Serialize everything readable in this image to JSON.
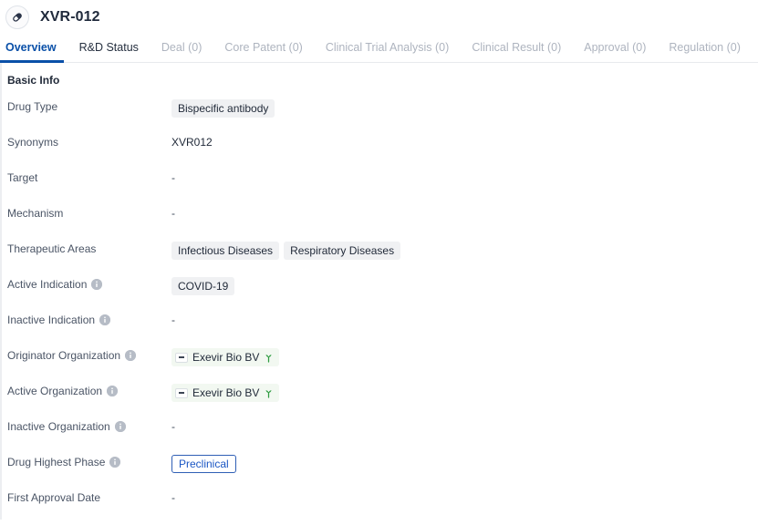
{
  "header": {
    "title": "XVR-012",
    "icon": "pill-capsule-icon"
  },
  "tabs": [
    {
      "label": "Overview",
      "state": "active"
    },
    {
      "label": "R&D Status",
      "state": "enabled"
    },
    {
      "label": "Deal (0)",
      "state": "disabled"
    },
    {
      "label": "Core Patent (0)",
      "state": "disabled"
    },
    {
      "label": "Clinical Trial Analysis (0)",
      "state": "disabled"
    },
    {
      "label": "Clinical Result (0)",
      "state": "disabled"
    },
    {
      "label": "Approval (0)",
      "state": "disabled"
    },
    {
      "label": "Regulation (0)",
      "state": "disabled"
    }
  ],
  "section": {
    "title": "Basic Info"
  },
  "fields": {
    "drug_type": {
      "label": "Drug Type",
      "tags": [
        "Bispecific antibody"
      ]
    },
    "synonyms": {
      "label": "Synonyms",
      "value": "XVR012"
    },
    "target": {
      "label": "Target",
      "value": "-"
    },
    "mechanism": {
      "label": "Mechanism",
      "value": "-"
    },
    "therapeutic_areas": {
      "label": "Therapeutic Areas",
      "tags": [
        "Infectious Diseases",
        "Respiratory Diseases"
      ]
    },
    "active_indication": {
      "label": "Active Indication",
      "has_info": true,
      "tags": [
        "COVID-19"
      ]
    },
    "inactive_indication": {
      "label": "Inactive Indication",
      "has_info": true,
      "value": "-"
    },
    "originator_organization": {
      "label": "Originator Organization",
      "has_info": true,
      "orgs": [
        "Exevir Bio BV"
      ]
    },
    "active_organization": {
      "label": "Active Organization",
      "has_info": true,
      "orgs": [
        "Exevir Bio BV"
      ]
    },
    "inactive_organization": {
      "label": "Inactive Organization",
      "has_info": true,
      "value": "-"
    },
    "drug_highest_phase": {
      "label": "Drug Highest Phase",
      "has_info": true,
      "phase": "Preclinical"
    },
    "first_approval_date": {
      "label": "First Approval Date",
      "value": "-"
    }
  },
  "colors": {
    "accent_blue": "#0a50a8",
    "phase_blue": "#1a56c4",
    "tag_gray_bg": "#f0f1f3",
    "org_tag_bg": "#f2f8f1",
    "sprout_green": "#2c9b3f",
    "label_gray": "#4a5465",
    "disabled_tab": "#aeb4bf"
  }
}
